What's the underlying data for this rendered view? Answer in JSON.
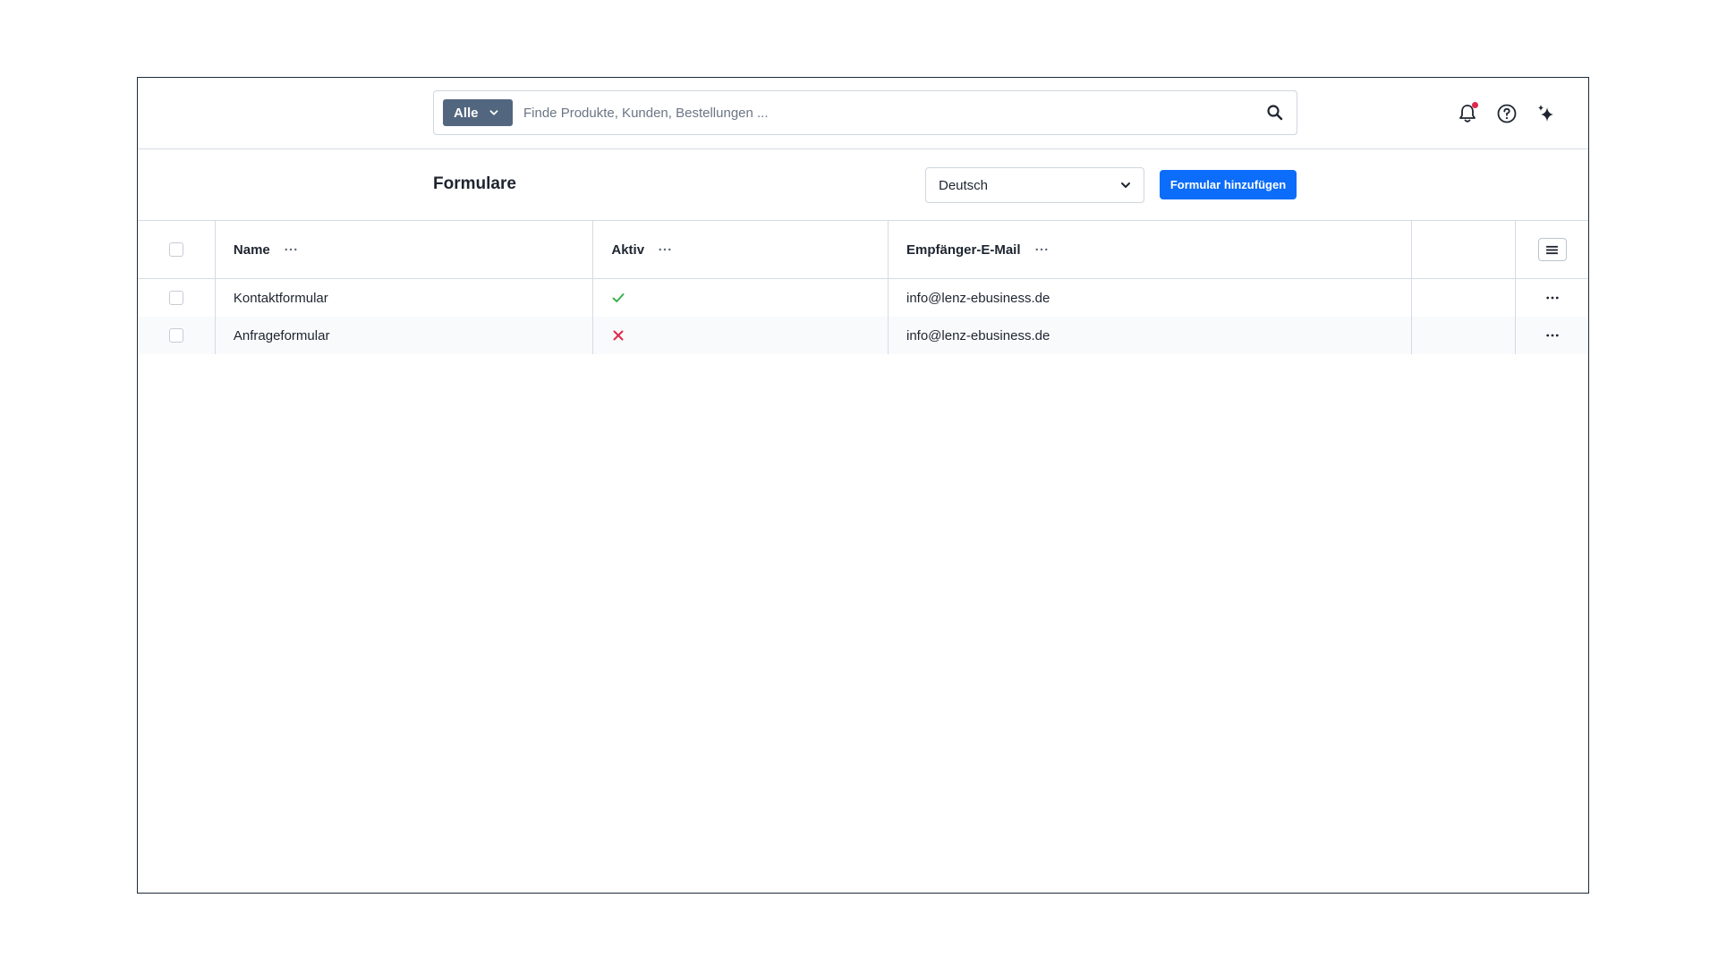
{
  "search": {
    "scope_label": "Alle",
    "placeholder": "Finde Produkte, Kunden, Bestellungen ..."
  },
  "page": {
    "title": "Formulare",
    "language_select": "Deutsch",
    "add_button_label": "Formular hinzufügen"
  },
  "table": {
    "columns": [
      "Name",
      "Aktiv",
      "Empfänger-E-Mail"
    ],
    "rows": [
      {
        "name": "Kontaktformular",
        "active": true,
        "email": "info@lenz-ebusiness.de"
      },
      {
        "name": "Anfrageformular",
        "active": false,
        "email": "info@lenz-ebusiness.de"
      }
    ]
  },
  "colors": {
    "accent": "#0b6dfa",
    "scope_button": "#52677f",
    "active_check": "#37b24d",
    "inactive_cross": "#de294c",
    "notification_dot": "#de294c"
  },
  "icons": {
    "search": "search-icon",
    "notifications": "bell-icon",
    "help": "help-icon",
    "ai": "sparkle-icon",
    "grid_settings": "hamburger-icon",
    "row_actions": "more-icon"
  }
}
